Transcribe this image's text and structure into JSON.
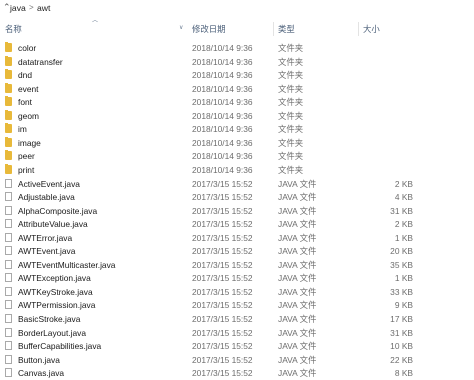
{
  "address": {
    "up_icon": "chevron-up-icon",
    "crumbs": [
      "java",
      "awt"
    ],
    "separator": ">"
  },
  "columns": {
    "name": "名称",
    "date": "修改日期",
    "type": "类型",
    "size": "大小"
  },
  "colors": {
    "folder": "#e8b93a",
    "header_text": "#4c607a",
    "selected_header": "#dbeaf7"
  },
  "rows": [
    {
      "kind": "folder",
      "name": "color",
      "date": "2018/10/14 9:36",
      "type": "文件夹",
      "size": ""
    },
    {
      "kind": "folder",
      "name": "datatransfer",
      "date": "2018/10/14 9:36",
      "type": "文件夹",
      "size": ""
    },
    {
      "kind": "folder",
      "name": "dnd",
      "date": "2018/10/14 9:36",
      "type": "文件夹",
      "size": ""
    },
    {
      "kind": "folder",
      "name": "event",
      "date": "2018/10/14 9:36",
      "type": "文件夹",
      "size": ""
    },
    {
      "kind": "folder",
      "name": "font",
      "date": "2018/10/14 9:36",
      "type": "文件夹",
      "size": ""
    },
    {
      "kind": "folder",
      "name": "geom",
      "date": "2018/10/14 9:36",
      "type": "文件夹",
      "size": ""
    },
    {
      "kind": "folder",
      "name": "im",
      "date": "2018/10/14 9:36",
      "type": "文件夹",
      "size": ""
    },
    {
      "kind": "folder",
      "name": "image",
      "date": "2018/10/14 9:36",
      "type": "文件夹",
      "size": ""
    },
    {
      "kind": "folder",
      "name": "peer",
      "date": "2018/10/14 9:36",
      "type": "文件夹",
      "size": ""
    },
    {
      "kind": "folder",
      "name": "print",
      "date": "2018/10/14 9:36",
      "type": "文件夹",
      "size": ""
    },
    {
      "kind": "file",
      "name": "ActiveEvent.java",
      "date": "2017/3/15 15:52",
      "type": "JAVA 文件",
      "size": "2 KB"
    },
    {
      "kind": "file",
      "name": "Adjustable.java",
      "date": "2017/3/15 15:52",
      "type": "JAVA 文件",
      "size": "4 KB"
    },
    {
      "kind": "file",
      "name": "AlphaComposite.java",
      "date": "2017/3/15 15:52",
      "type": "JAVA 文件",
      "size": "31 KB"
    },
    {
      "kind": "file",
      "name": "AttributeValue.java",
      "date": "2017/3/15 15:52",
      "type": "JAVA 文件",
      "size": "2 KB"
    },
    {
      "kind": "file",
      "name": "AWTError.java",
      "date": "2017/3/15 15:52",
      "type": "JAVA 文件",
      "size": "1 KB"
    },
    {
      "kind": "file",
      "name": "AWTEvent.java",
      "date": "2017/3/15 15:52",
      "type": "JAVA 文件",
      "size": "20 KB"
    },
    {
      "kind": "file",
      "name": "AWTEventMulticaster.java",
      "date": "2017/3/15 15:52",
      "type": "JAVA 文件",
      "size": "35 KB"
    },
    {
      "kind": "file",
      "name": "AWTException.java",
      "date": "2017/3/15 15:52",
      "type": "JAVA 文件",
      "size": "1 KB"
    },
    {
      "kind": "file",
      "name": "AWTKeyStroke.java",
      "date": "2017/3/15 15:52",
      "type": "JAVA 文件",
      "size": "33 KB"
    },
    {
      "kind": "file",
      "name": "AWTPermission.java",
      "date": "2017/3/15 15:52",
      "type": "JAVA 文件",
      "size": "9 KB"
    },
    {
      "kind": "file",
      "name": "BasicStroke.java",
      "date": "2017/3/15 15:52",
      "type": "JAVA 文件",
      "size": "17 KB"
    },
    {
      "kind": "file",
      "name": "BorderLayout.java",
      "date": "2017/3/15 15:52",
      "type": "JAVA 文件",
      "size": "31 KB"
    },
    {
      "kind": "file",
      "name": "BufferCapabilities.java",
      "date": "2017/3/15 15:52",
      "type": "JAVA 文件",
      "size": "10 KB"
    },
    {
      "kind": "file",
      "name": "Button.java",
      "date": "2017/3/15 15:52",
      "type": "JAVA 文件",
      "size": "22 KB"
    },
    {
      "kind": "file",
      "name": "Canvas.java",
      "date": "2017/3/15 15:52",
      "type": "JAVA 文件",
      "size": "8 KB"
    }
  ]
}
